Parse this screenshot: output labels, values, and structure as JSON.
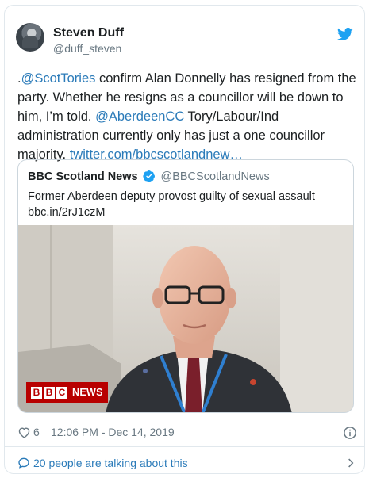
{
  "author": {
    "name": "Steven Duff",
    "handle": "@duff_steven"
  },
  "tweet": {
    "prefix": ".",
    "mention1": "@ScotTories",
    "text1": " confirm Alan Donnelly has resigned from the party. Whether he resigns as a councillor will be down to him, I’m told. ",
    "mention2": "@AberdeenCC",
    "text2": " Tory/Labour/Ind administration currently only has just a one councillor majority. ",
    "link": "twitter.com/bbcscotlandnew…"
  },
  "quoted": {
    "name": "BBC Scotland News",
    "handle": "@BBCScotlandNews",
    "text_line1": "Former Aberdeen deputy provost guilty of sexual assault",
    "text_line2": "bbc.in/2rJ1czM",
    "media_logo_letters": [
      "B",
      "B",
      "C"
    ],
    "media_logo_word": "NEWS"
  },
  "footer": {
    "likes": "6",
    "timestamp": "12:06 PM - Dec 14, 2019",
    "talking": "20 people are talking about this"
  },
  "colors": {
    "link": "#2b7bb9",
    "twitter_blue": "#1da1f2",
    "bbc_red": "#b80000"
  },
  "icons": [
    "twitter-bird-icon",
    "verified-badge-icon",
    "heart-icon",
    "info-icon",
    "speech-bubble-icon",
    "chevron-right-icon"
  ]
}
